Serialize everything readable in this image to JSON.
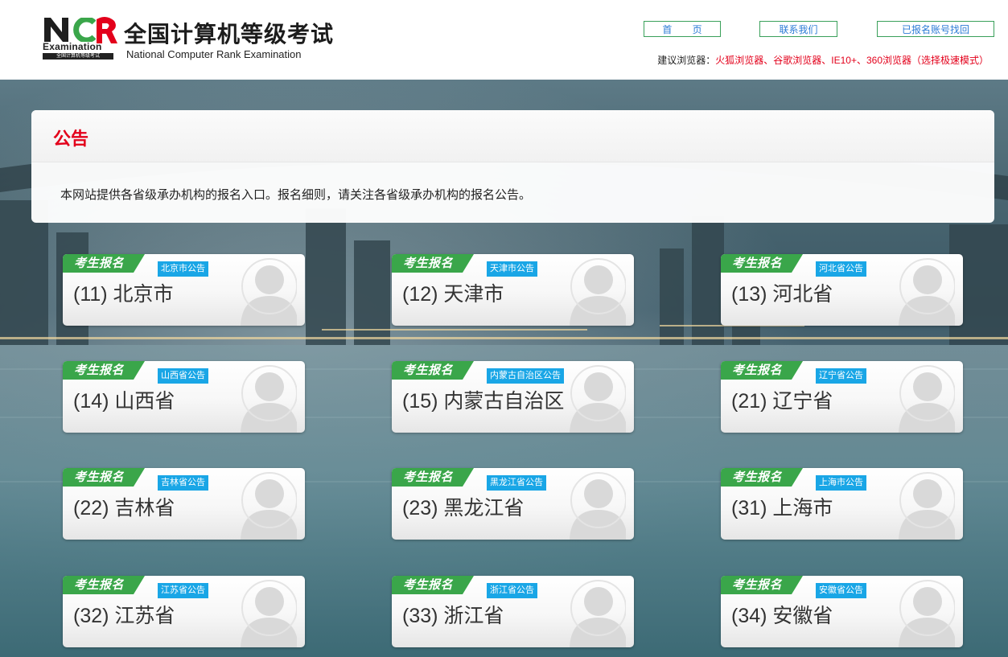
{
  "header": {
    "logo_text": "Examination",
    "logo_strip": "全国计算机等级考试",
    "title": "全国计算机等级考试",
    "subtitle": "National Computer Rank Examination",
    "nav": {
      "home": "首 页",
      "contact": "联系我们",
      "recover": "已报名账号找回"
    },
    "browser_tip_label": "建议浏览器：",
    "browser_tip_value": "火狐浏览器、谷歌浏览器、IE10+、360浏览器（选择极速模式）",
    "accent_color": "#e3001b",
    "nav_border_color": "#3aa05a"
  },
  "notice": {
    "title": "公告",
    "text": "本网站提供各省级承办机构的报名入口。报名细则，请关注各省级承办机构的报名公告。"
  },
  "card_badge_label": "考生报名",
  "colors": {
    "badge_green": "#3aa64a",
    "tag_blue": "#19a6e6"
  },
  "provinces": [
    {
      "name": "(11) 北京市",
      "tag": "北京市公告"
    },
    {
      "name": "(12) 天津市",
      "tag": "天津市公告"
    },
    {
      "name": "(13) 河北省",
      "tag": "河北省公告"
    },
    {
      "name": "(14) 山西省",
      "tag": "山西省公告"
    },
    {
      "name": "(15) 内蒙古自治区",
      "tag": "内蒙古自治区公告"
    },
    {
      "name": "(21) 辽宁省",
      "tag": "辽宁省公告"
    },
    {
      "name": "(22) 吉林省",
      "tag": "吉林省公告"
    },
    {
      "name": "(23) 黑龙江省",
      "tag": "黑龙江省公告"
    },
    {
      "name": "(31) 上海市",
      "tag": "上海市公告"
    },
    {
      "name": "(32) 江苏省",
      "tag": "江苏省公告"
    },
    {
      "name": "(33) 浙江省",
      "tag": "浙江省公告"
    },
    {
      "name": "(34) 安徽省",
      "tag": "安徽省公告"
    }
  ]
}
